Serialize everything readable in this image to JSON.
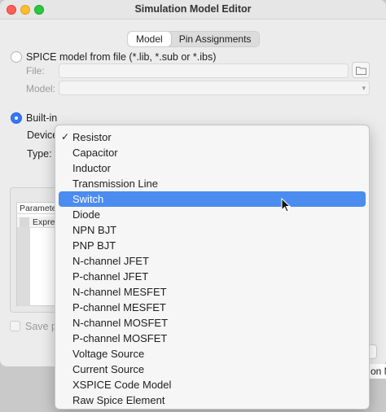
{
  "window": {
    "title": "Simulation Model Editor"
  },
  "tabs": [
    {
      "label": "Model",
      "active": true
    },
    {
      "label": "Pin Assignments",
      "active": false
    }
  ],
  "spice_option": {
    "label": "SPICE model from file (*.lib, *.sub or *.ibs)",
    "selected": false,
    "file_label": "File:",
    "file_value": "",
    "model_label": "Model:",
    "model_value": ""
  },
  "builtin_option": {
    "label": "Built-in",
    "selected": true,
    "device_label": "Device",
    "type_label": "Type:"
  },
  "parameters": {
    "header": "Parameter",
    "subheader": "Express"
  },
  "save_checkbox": {
    "label": "Save pr",
    "checked": false
  },
  "background_window_text": "on M",
  "dropdown": {
    "selected_index": 0,
    "highlighted_index": 4,
    "check_glyph": "✓",
    "items": [
      "Resistor",
      "Capacitor",
      "Inductor",
      "Transmission Line",
      "Switch",
      "Diode",
      "NPN BJT",
      "PNP BJT",
      "N-channel JFET",
      "P-channel JFET",
      "N-channel MESFET",
      "P-channel MESFET",
      "N-channel MOSFET",
      "P-channel MOSFET",
      "Voltage Source",
      "Current Source",
      "XSPICE Code Model",
      "Raw Spice Element"
    ]
  },
  "colors": {
    "accent": "#3478f6",
    "menu_highlight": "#4b8cf0"
  },
  "icons": {
    "folder": "folder-icon",
    "cursor": "mouse-pointer-icon"
  }
}
